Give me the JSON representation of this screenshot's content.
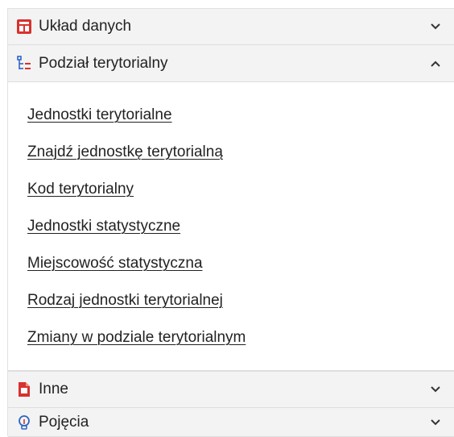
{
  "sections": [
    {
      "label": "Układ danych",
      "icon": "table-layout-icon",
      "expanded": false
    },
    {
      "label": "Podział terytorialny",
      "icon": "hierarchy-list-icon",
      "expanded": true
    },
    {
      "label": "Inne",
      "icon": "document-icon",
      "expanded": false
    },
    {
      "label": "Pojęcia",
      "icon": "lightbulb-icon",
      "expanded": false
    }
  ],
  "territorial_links": [
    "Jednostki terytorialne",
    "Znajdź jednostkę terytorialną",
    "Kod terytorialny",
    "Jednostki statystyczne",
    "Miejscowość statystyczna",
    "Rodzaj jednostki terytorialnej",
    "Zmiany w podziale terytorialnym"
  ],
  "colors": {
    "accent_red": "#d9312e",
    "accent_blue": "#2f66c6",
    "header_bg": "#f3f3f3"
  }
}
